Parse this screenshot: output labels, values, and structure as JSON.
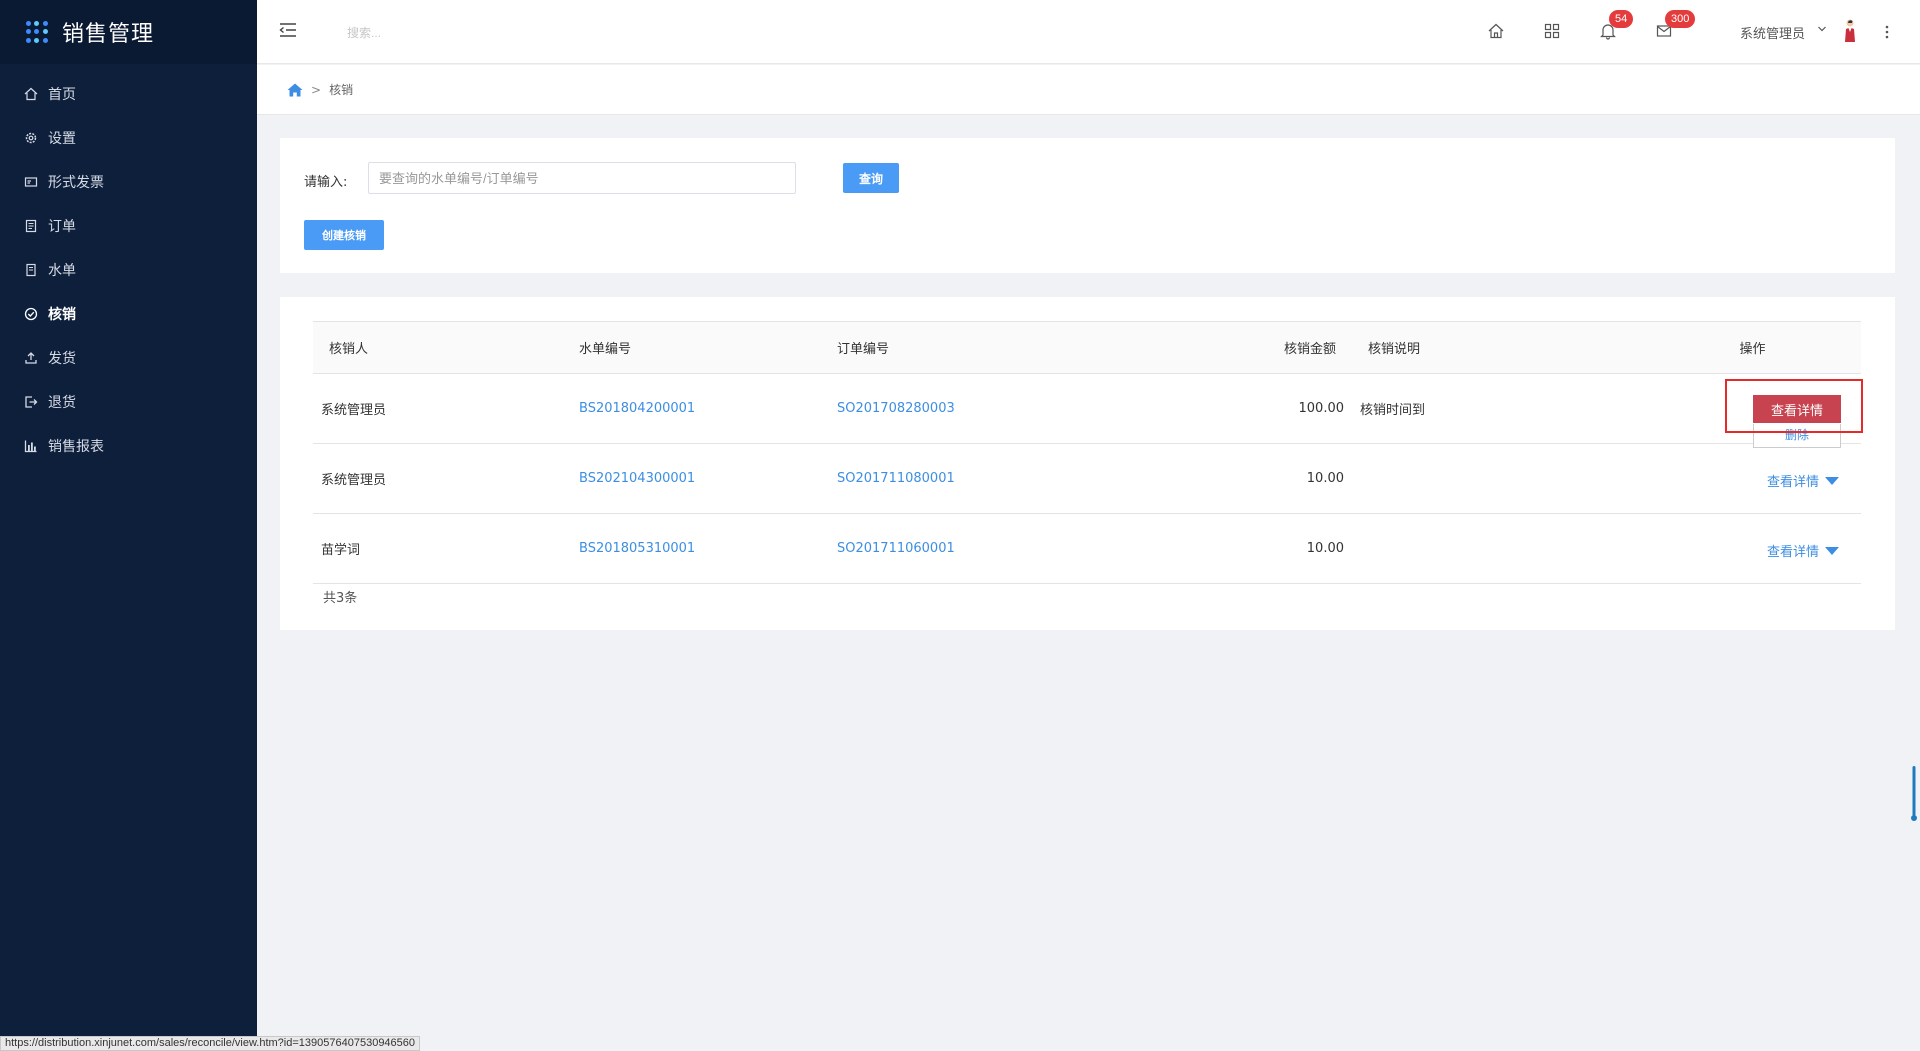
{
  "app": {
    "title": "销售管理"
  },
  "sidebar": {
    "items": [
      {
        "label": "首页",
        "icon": "home-icon"
      },
      {
        "label": "设置",
        "icon": "gear-icon"
      },
      {
        "label": "形式发票",
        "icon": "invoice-icon"
      },
      {
        "label": "订单",
        "icon": "order-icon"
      },
      {
        "label": "水单",
        "icon": "receipt-icon"
      },
      {
        "label": "核销",
        "icon": "check-circle-icon",
        "active": true
      },
      {
        "label": "发货",
        "icon": "upload-icon"
      },
      {
        "label": "退货",
        "icon": "return-icon"
      },
      {
        "label": "销售报表",
        "icon": "bar-chart-icon"
      }
    ]
  },
  "header": {
    "search_placeholder": "搜索...",
    "notifications_count": "54",
    "messages_count": "300",
    "user_name": "系统管理员"
  },
  "breadcrumb": {
    "separator": ">",
    "current": "核销"
  },
  "search_panel": {
    "input_label": "请输入:",
    "input_placeholder": "要查询的水单编号/订单编号",
    "input_value": "",
    "query_button": "查询",
    "create_button": "创建核销"
  },
  "table": {
    "columns": [
      "核销人",
      "水单编号",
      "订单编号",
      "核销金额",
      "核销说明",
      "操作"
    ],
    "rows": [
      {
        "person": "系统管理员",
        "slip_no": "BS201804200001",
        "order_no": "SO201708280003",
        "amount": "100.00",
        "note": "核销时间到",
        "action": "查看详情",
        "dropdown": "删除"
      },
      {
        "person": "系统管理员",
        "slip_no": "BS202104300001",
        "order_no": "SO201711080001",
        "amount": "10.00",
        "note": "",
        "action": "查看详情"
      },
      {
        "person": "苗学词",
        "slip_no": "BS201805310001",
        "order_no": "SO201711060001",
        "amount": "10.00",
        "note": "",
        "action": "查看详情"
      }
    ],
    "total": "共3条"
  },
  "status_bar": {
    "url": "https://distribution.xinjunet.com/sales/reconcile/view.htm?id=1390576407530946560"
  },
  "colors": {
    "sidebar_bg": "#0e1f3c",
    "primary": "#4a9bf5",
    "link": "#3d8ee3",
    "danger": "#c7434f",
    "highlight": "#e52a2a"
  }
}
